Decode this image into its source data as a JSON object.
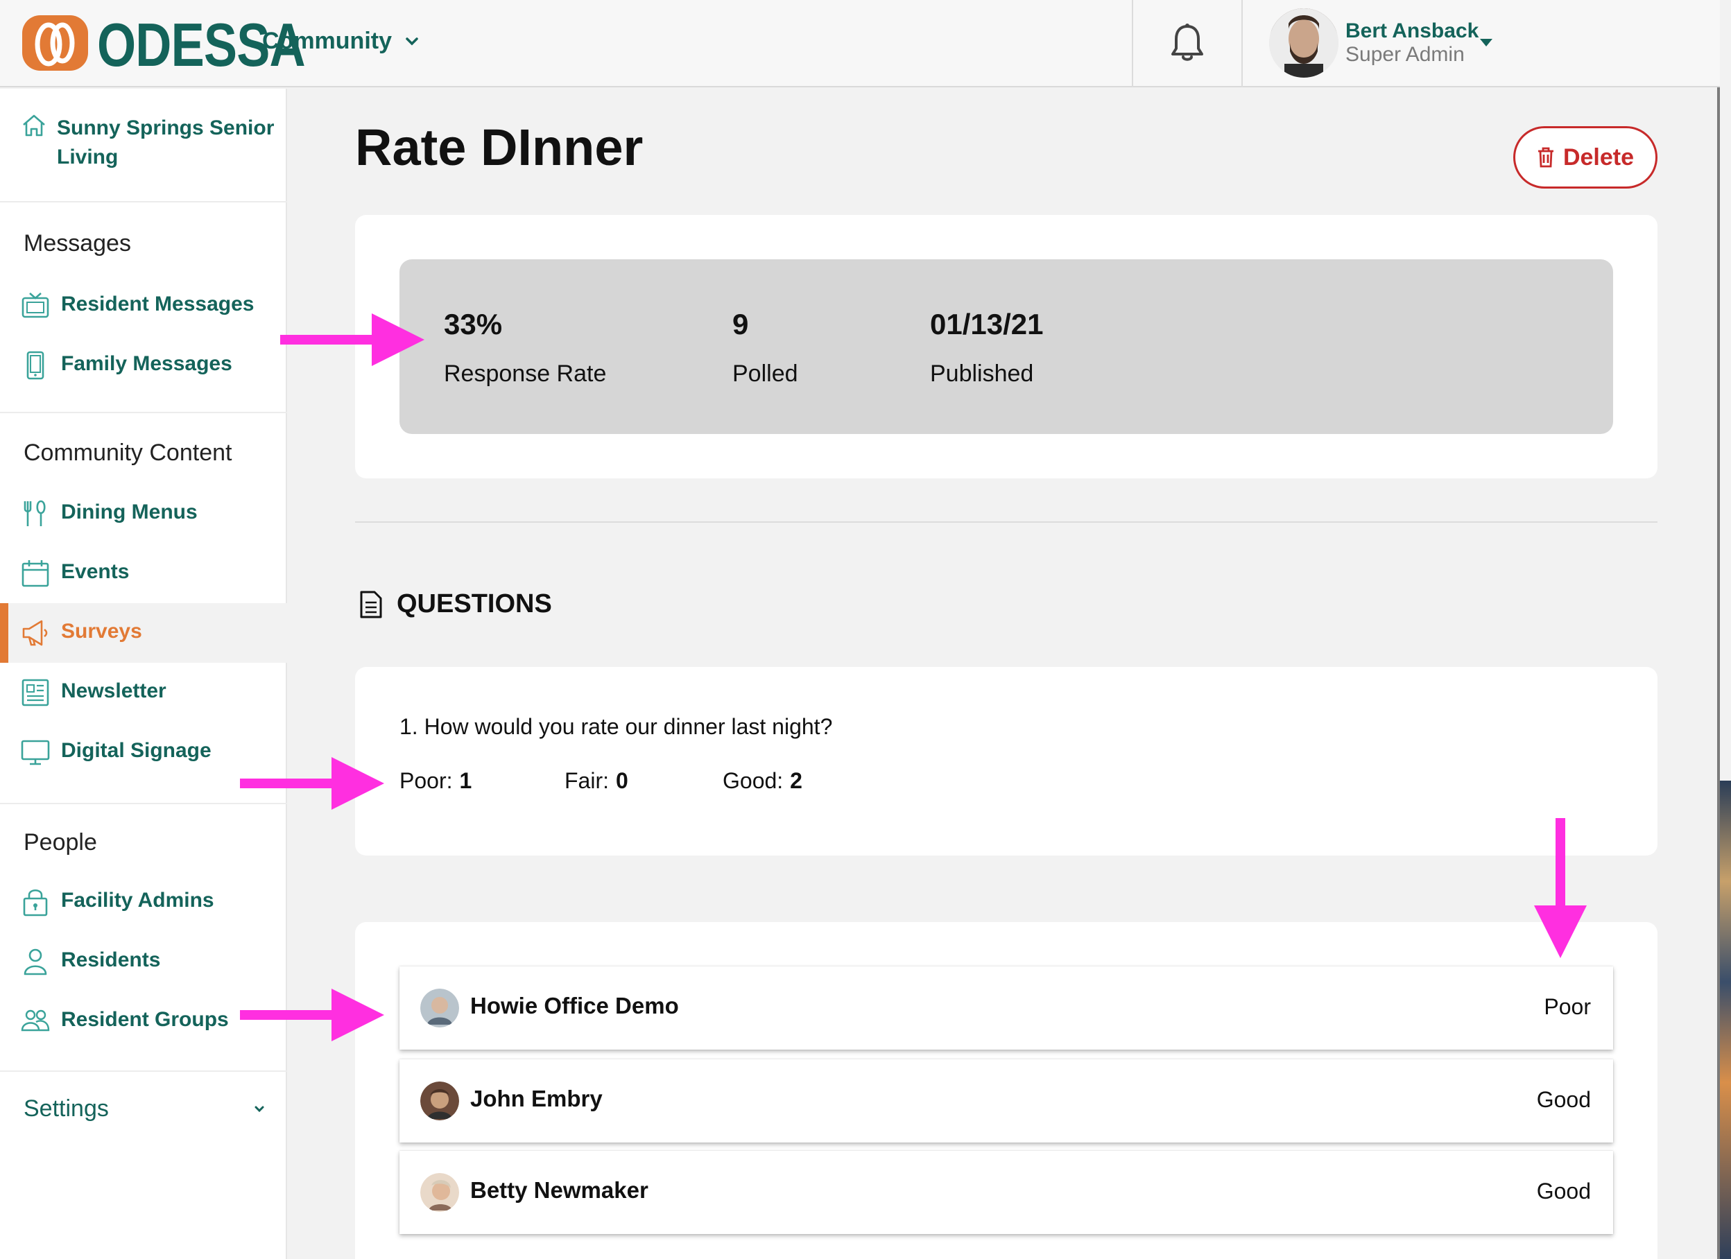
{
  "header": {
    "logo_text": "ODESSA",
    "community_label": "Community",
    "user": {
      "name": "Bert Ansback",
      "role": "Super Admin"
    }
  },
  "sidebar": {
    "home_label": "Sunny Springs Senior Living",
    "sections": [
      {
        "heading": "Messages",
        "items": [
          {
            "label": "Resident Messages",
            "icon": "tv-icon"
          },
          {
            "label": "Family Messages",
            "icon": "phone-icon"
          }
        ]
      },
      {
        "heading": "Community Content",
        "items": [
          {
            "label": "Dining Menus",
            "icon": "utensils-icon"
          },
          {
            "label": "Events",
            "icon": "calendar-icon"
          },
          {
            "label": "Surveys",
            "icon": "megaphone-icon",
            "active": true
          },
          {
            "label": "Newsletter",
            "icon": "newsletter-icon"
          },
          {
            "label": "Digital Signage",
            "icon": "monitor-icon"
          }
        ]
      },
      {
        "heading": "People",
        "items": [
          {
            "label": "Facility Admins",
            "icon": "lock-icon"
          },
          {
            "label": "Residents",
            "icon": "person-icon"
          },
          {
            "label": "Resident Groups",
            "icon": "group-icon"
          }
        ]
      }
    ],
    "settings_label": "Settings"
  },
  "main": {
    "title": "Rate DInner",
    "delete_label": "Delete",
    "stats": [
      {
        "value": "33%",
        "caption": "Response Rate"
      },
      {
        "value": "9",
        "caption": "Polled"
      },
      {
        "value": "01/13/21",
        "caption": "Published"
      }
    ],
    "questions_heading": "QUESTIONS",
    "question": {
      "text": "1. How would you rate our dinner last night?",
      "answers": [
        {
          "label": "Poor:",
          "count": "1"
        },
        {
          "label": "Fair:",
          "count": "0"
        },
        {
          "label": "Good:",
          "count": "2"
        }
      ]
    },
    "responses": [
      {
        "name": "Howie Office Demo",
        "rating": "Poor"
      },
      {
        "name": "John Embry",
        "rating": "Good"
      },
      {
        "name": "Betty Newmaker",
        "rating": "Good"
      }
    ]
  },
  "colors": {
    "brand_green": "#14635a",
    "brand_orange": "#e27a35",
    "danger_red": "#c72a2a",
    "annotation_magenta": "#ff2fe0"
  }
}
